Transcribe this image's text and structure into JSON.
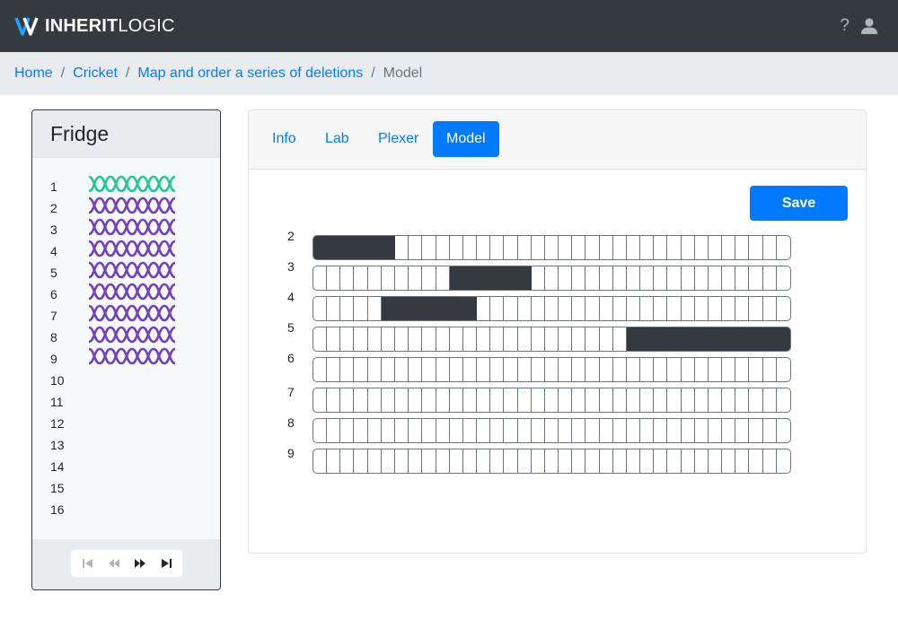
{
  "navbar": {
    "brand_bold": "INHERIT",
    "brand_light": "LOGIC",
    "help_label": "?",
    "icons": {
      "logo": "dna-logo-icon",
      "help": "question-icon",
      "user": "user-icon"
    }
  },
  "breadcrumb": {
    "items": [
      "Home",
      "Cricket",
      "Map and order a series of deletions"
    ],
    "active": "Model",
    "separator": "/"
  },
  "fridge": {
    "title": "Fridge",
    "slots": [
      "1",
      "2",
      "3",
      "4",
      "5",
      "6",
      "7",
      "8",
      "9",
      "10",
      "11",
      "12",
      "13",
      "14",
      "15",
      "16"
    ],
    "strains": [
      {
        "slot": "1",
        "color": "#20c997"
      },
      {
        "slot": "2",
        "color": "#6f42c1"
      },
      {
        "slot": "3",
        "color": "#6f42c1"
      },
      {
        "slot": "4",
        "color": "#6f42c1"
      },
      {
        "slot": "5",
        "color": "#6f42c1"
      },
      {
        "slot": "6",
        "color": "#6f42c1"
      },
      {
        "slot": "7",
        "color": "#6f42c1"
      },
      {
        "slot": "8",
        "color": "#6f42c1"
      },
      {
        "slot": "9",
        "color": "#6f42c1"
      }
    ],
    "player_controls": [
      "first-icon",
      "rewind-icon",
      "fast-forward-icon",
      "last-icon"
    ]
  },
  "tabs": [
    {
      "label": "Info",
      "active": false
    },
    {
      "label": "Lab",
      "active": false
    },
    {
      "label": "Plexer",
      "active": false
    },
    {
      "label": "Model",
      "active": true
    }
  ],
  "save_label": "Save",
  "model": {
    "cells_per_strand": 35,
    "rows": [
      {
        "label": "2",
        "deletion": [
          0,
          6
        ]
      },
      {
        "label": "3",
        "deletion": [
          10,
          16
        ]
      },
      {
        "label": "4",
        "deletion": [
          5,
          12
        ]
      },
      {
        "label": "5",
        "deletion": [
          23,
          35
        ]
      },
      {
        "label": "6",
        "deletion": null
      },
      {
        "label": "7",
        "deletion": null
      },
      {
        "label": "8",
        "deletion": null
      },
      {
        "label": "9",
        "deletion": null
      }
    ]
  },
  "colors": {
    "navbar": "#343a40",
    "accent": "#007bff",
    "deletion": "#343a40",
    "wildtype_strain": "#20c997",
    "mutant_strain": "#6f42c1"
  }
}
